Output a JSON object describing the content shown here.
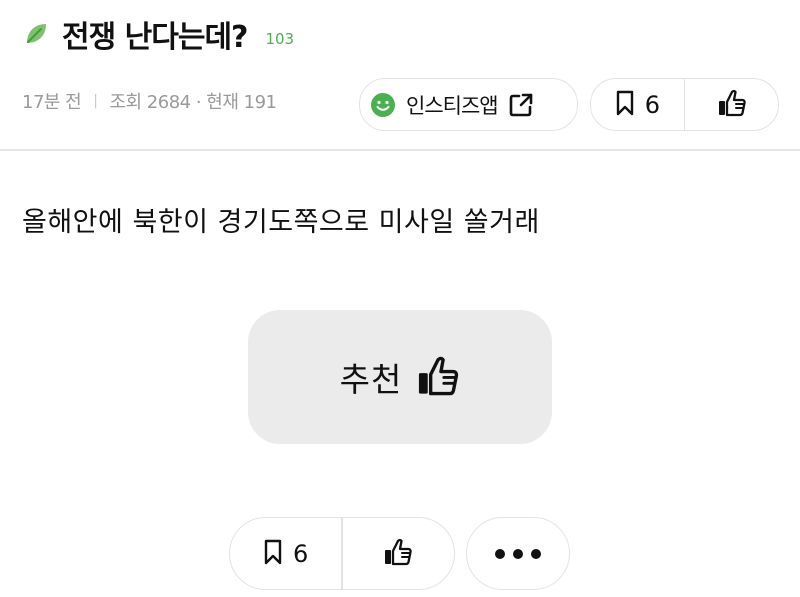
{
  "post": {
    "title": "전쟁 난다는데?",
    "comment_count": "103",
    "time": "17분 전",
    "views": "조회 2684 · 현재 191",
    "body": "올해안에 북한이 경기도쪽으로 미사일 쏠거래"
  },
  "header_actions": {
    "app_label": "인스티즈앱",
    "bookmark_count": "6"
  },
  "recommend": {
    "label": "추천"
  },
  "bottom_actions": {
    "bookmark_count": "6"
  },
  "icons": [
    "leaf-icon",
    "smile-icon",
    "external-link-icon",
    "bookmark-icon",
    "thumbs-up-icon",
    "more-icon"
  ],
  "colors": {
    "accent_green": "#4caf50",
    "button_bg": "#ebebeb",
    "border": "#e3e3e3",
    "meta_gray": "#9a9a9a"
  }
}
